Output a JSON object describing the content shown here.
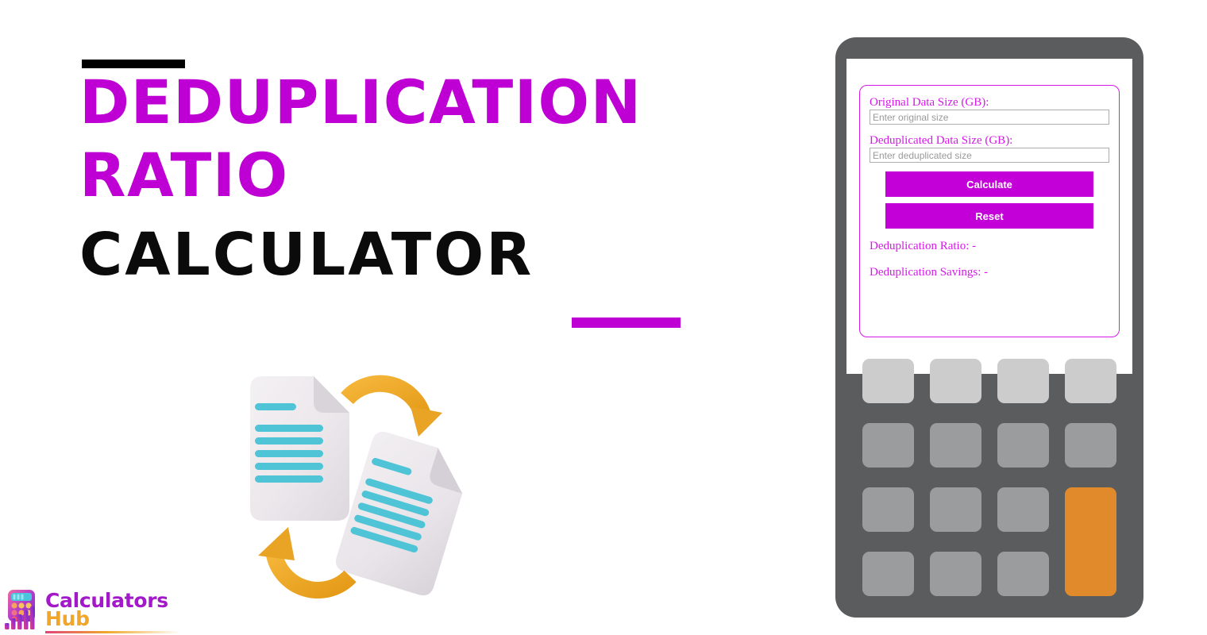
{
  "page": {
    "background": "#ffffff",
    "accent_magenta": "#bf00d4",
    "accent_orange": "#e08a2b",
    "device_body": "#5a5c5e"
  },
  "hero": {
    "title_line_1": "Deduplication",
    "title_line_2": "Ratio",
    "title_line_3": "Calculator",
    "rule_top_color": "#000000",
    "rule_bottom_color": "#bf00d4"
  },
  "illustration": {
    "name": "two-documents-with-circular-arrows",
    "document_color": "#ece9ec",
    "text_line_color": "#4fc4d6",
    "arrow_color": "#efa92b"
  },
  "brand": {
    "word_1": "Calculators",
    "word_2": "Hub",
    "word_1_color": "#a318c8",
    "word_2_color": "#f0a62a",
    "mark_name": "calculator-bar-chart-logo"
  },
  "calculator": {
    "form": {
      "fields": [
        {
          "label": "Original Data Size (GB):",
          "placeholder": "Enter original size",
          "value": ""
        },
        {
          "label": "Deduplicated Data Size (GB):",
          "placeholder": "Enter deduplicated size",
          "value": ""
        }
      ],
      "buttons": {
        "calculate": "Calculate",
        "reset": "Reset",
        "color": "#c400d9"
      },
      "results": [
        "Deduplication Ratio: -",
        "Deduplication Savings: -"
      ],
      "border_color": "#d619e8",
      "label_color": "#d619e8"
    },
    "keypad": {
      "rows": 4,
      "columns": 4,
      "row_1_color": "#cccccc",
      "other_rows_color": "#9a9c9e",
      "accent_key_color": "#e08a2b",
      "accent_key_span_rows": 2
    }
  }
}
